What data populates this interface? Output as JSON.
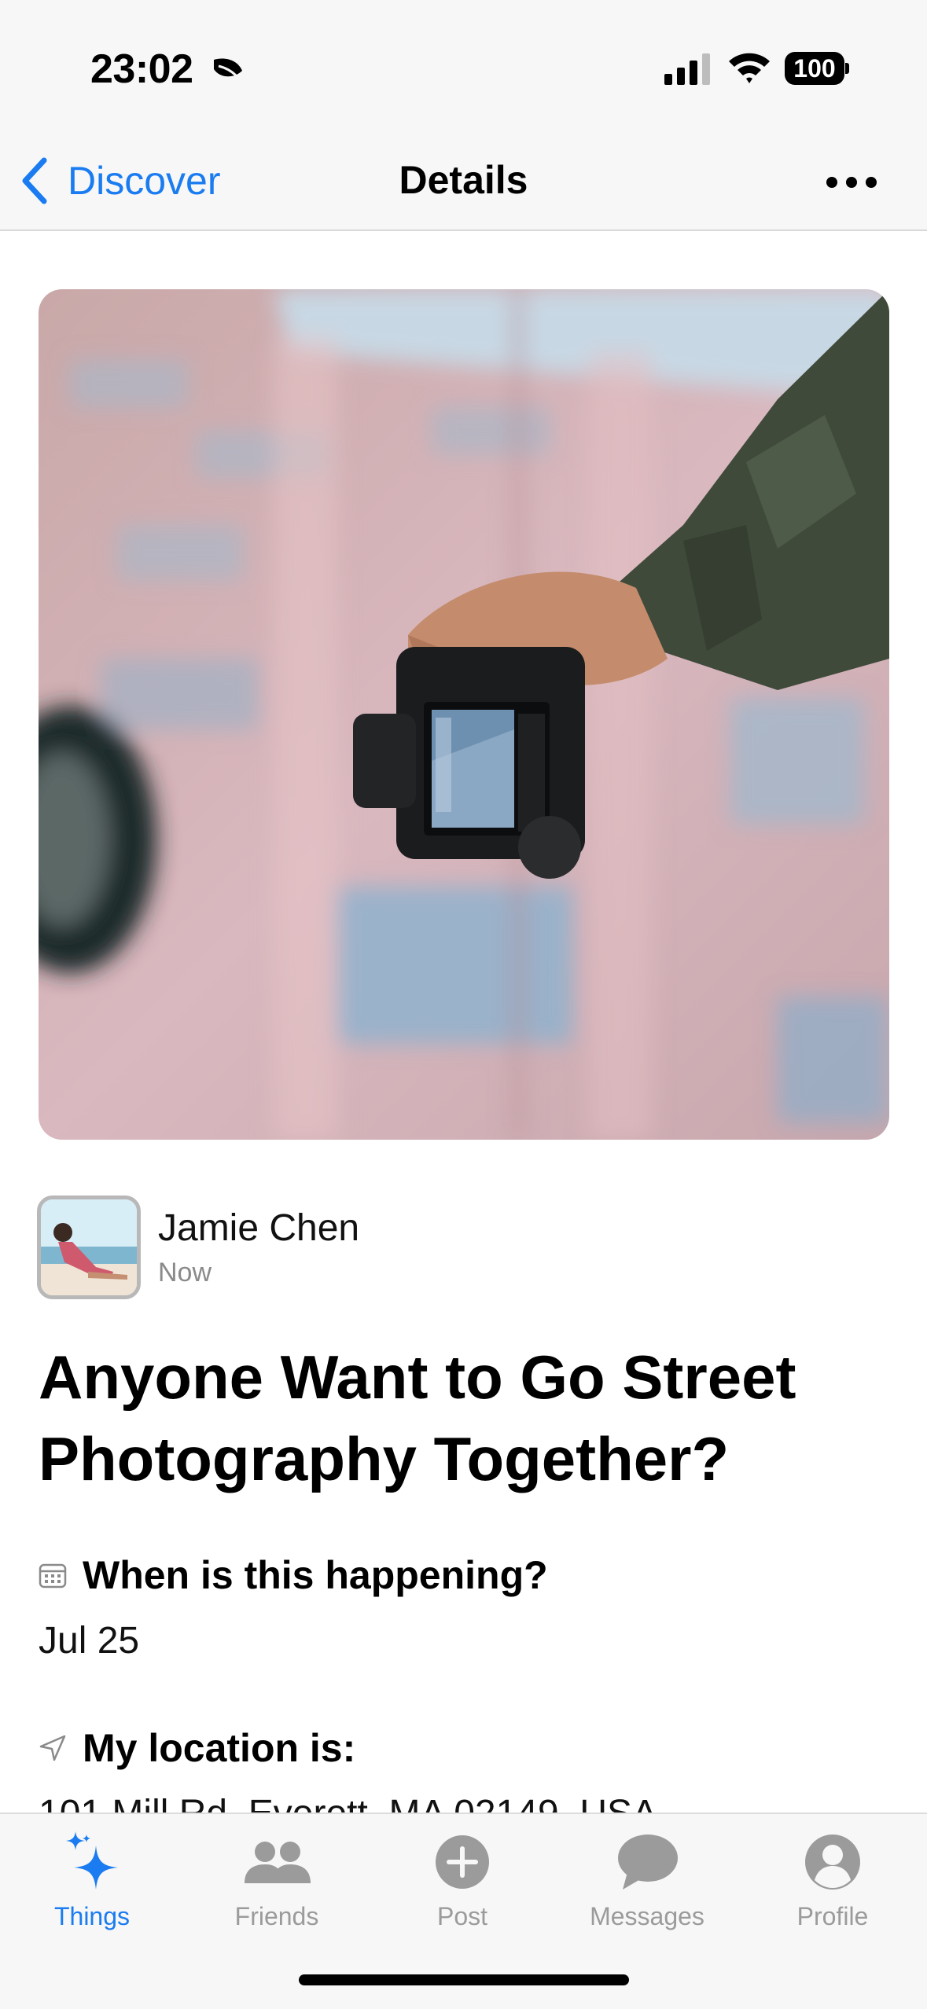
{
  "status": {
    "time": "23:02",
    "battery": "100"
  },
  "nav": {
    "back_label": "Discover",
    "title": "Details"
  },
  "post": {
    "author": "Jamie Chen",
    "time": "Now",
    "title": "Anyone Want to Go Street Photography Together?",
    "when_label": "When is this happening?",
    "when_value": "Jul 25",
    "location_label": "My location is:",
    "location_value": "101 Mill Rd, Everett, MA 02149, USA"
  },
  "tabs": [
    {
      "label": "Things",
      "icon": "sparkle-icon",
      "active": true
    },
    {
      "label": "Friends",
      "icon": "friends-icon"
    },
    {
      "label": "Post",
      "icon": "plus-circle-icon"
    },
    {
      "label": "Messages",
      "icon": "chat-bubble-icon"
    },
    {
      "label": "Profile",
      "icon": "person-circle-icon"
    }
  ],
  "colors": {
    "accent": "#1a7cf0",
    "inactive_tab": "#9b9b9b"
  }
}
